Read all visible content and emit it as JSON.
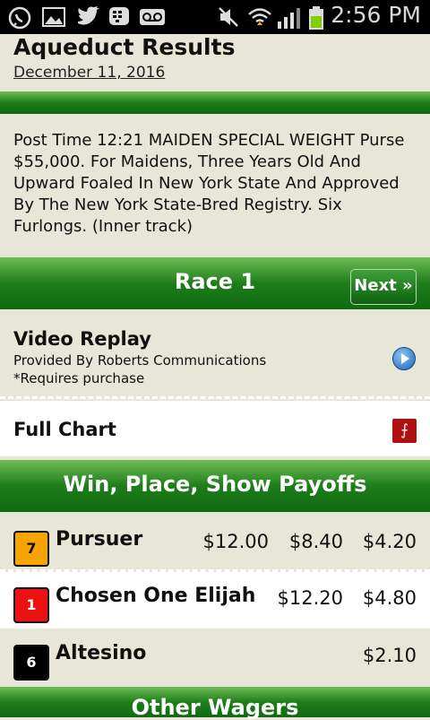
{
  "status_bar": {
    "time": "2:56 PM",
    "icons": [
      "whatsapp-icon",
      "image-icon",
      "twitter-icon",
      "bbm-icon",
      "voicemail-icon",
      "mute-icon",
      "wifi-icon",
      "signal-icon",
      "battery-icon"
    ]
  },
  "header": {
    "title": "Aqueduct Results",
    "date": "December 11, 2016"
  },
  "race_description": "Post Time 12:21 MAIDEN SPECIAL WEIGHT Purse $55,000. For Maidens, Three Years Old And Upward Foaled In New York State And Approved By The New York State-Bred Registry. Six Furlongs. (Inner track)",
  "race_nav": {
    "title": "Race 1",
    "next_label": "Next »"
  },
  "video": {
    "title": "Video Replay",
    "provider": "Provided By Roberts Communications",
    "note": "*Requires purchase"
  },
  "chart": {
    "label": "Full Chart"
  },
  "payoffs": {
    "title": "Win, Place, Show Payoffs",
    "rows": [
      {
        "number": "7",
        "badge_color": "#f7a400",
        "badge_text_color": "#111111",
        "name": "Pursuer",
        "win": "$12.00",
        "place": "$8.40",
        "show": "$4.20"
      },
      {
        "number": "1",
        "badge_color": "#ee1111",
        "badge_text_color": "#ffffff",
        "name": "Chosen One Elijah",
        "win": "",
        "place": "$12.20",
        "show": "$4.80"
      },
      {
        "number": "6",
        "badge_color": "#000000",
        "badge_text_color": "#ffffff",
        "name": "Altesino",
        "win": "",
        "place": "",
        "show": "$2.10"
      }
    ]
  },
  "other_wagers": {
    "title": "Other Wagers"
  }
}
